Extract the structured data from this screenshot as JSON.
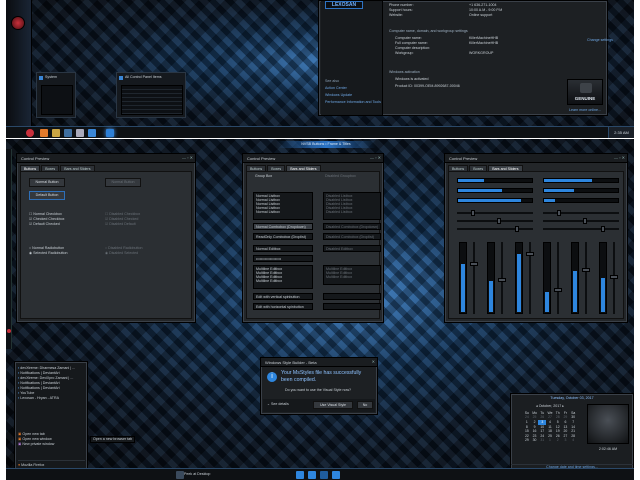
{
  "p1": {
    "logo": "LEXOSAN",
    "system_info": [
      {
        "label": "Phone number:",
        "value": "+1 636-271-1004"
      },
      {
        "label": "Support hours:",
        "value": "10:00 A.M - 9:00 P.M"
      },
      {
        "label": "Website:",
        "value": "Online support"
      }
    ],
    "section_computer": "Computer name, domain, and workgroup settings",
    "computer_rows": [
      {
        "label": "Computer name:",
        "value": "KillerMachineHHB"
      },
      {
        "label": "Full computer name:",
        "value": "KillerMachineHHB"
      },
      {
        "label": "Computer description:",
        "value": ""
      },
      {
        "label": "Workgroup:",
        "value": "WORKGROUP"
      }
    ],
    "change_settings": "Change settings",
    "section_activation": "Windows activation",
    "activation_status": "Windows is activated",
    "product_id": "Product ID: 00399-OEM-8992687-00046",
    "genuine": "GENUINE",
    "learn_more": "Learn more online...",
    "see_also_title": "See also",
    "see_also": [
      "Action Center",
      "Windows Update",
      "Performance Information and Tools"
    ],
    "thumb1": "System",
    "thumb2": "All Control Panel Items",
    "clock": "2:35 AM"
  },
  "p2": {
    "cp1": {
      "title": "Control Preview",
      "tabs": [
        "Buttons",
        "Boxes",
        "Bars and Sliders"
      ],
      "normal_button": "Normal Button",
      "default_button": "Default Button",
      "disabled_button": "Normal Button",
      "checks": [
        "Normal Checkbox",
        "Checked Checkbox",
        "Default Checked"
      ],
      "checks_disabled": [
        "Disabled Checkbox",
        "Disabled Checked",
        "Disabled Default"
      ],
      "radios": [
        "Normal Radiobutton",
        "Selected Radiobutton"
      ],
      "radios_disabled": [
        "Disabled Radiobutton",
        "Disabled Selected"
      ]
    },
    "cp2": {
      "title": "Control Preview",
      "tabs": [
        "Buttons",
        "Boxes",
        "Bars and Sliders"
      ],
      "group_box": "Group Box",
      "disabled_group": "Disabled Groupbox",
      "list_items": [
        "Normal Listbox",
        "Normal Listbox",
        "Normal Listbox",
        "Normal Listbox",
        "Normal Listbox"
      ],
      "list_items_disabled": [
        "Disabled Listbox",
        "Disabled Listbox",
        "Disabled Listbox",
        "Disabled Listbox",
        "Disabled Listbox"
      ],
      "combo_normal": "Normal Combobox (Dropdown)",
      "combo_disabled": "Disabled Combobox (Dropdown)",
      "combo_readonly": "ReadOnly Combobox (Droplist)",
      "combo_readonly_disabled": "Disabled Combobox (Droplist)",
      "edit_normal": "Normal Editbox",
      "edit_disabled": "Disabled Editbox",
      "password": "••••••••••••••••••••",
      "multiline": [
        "Multiline Editbox",
        "Multiline Editbox",
        "Multiline Editbox",
        "Multiline Editbox"
      ],
      "multiline_disabled": [
        "Multiline Editbox",
        "Multiline Editbox",
        "Multiline Editbox"
      ],
      "spin_vertical": "Edit with vertical spinbutton",
      "spin_horizontal": "Edit with horizontal spinbutton"
    },
    "cp3": {
      "title": "Control Preview",
      "tabs": [
        "Buttons",
        "Boxes",
        "Bars and Sliders"
      ],
      "h_progress": [
        0.35,
        0.6,
        0.85
      ],
      "h_sliders": [
        0.2,
        0.55,
        0.8
      ],
      "v_levels": [
        0.7,
        0.45,
        0.85,
        0.3,
        0.6,
        0.5
      ]
    },
    "jumplist": {
      "items": [
        "devXtreme: Dharmesa Zamani | ...",
        "Notifications | DeviantArt",
        "devXtreme: DeviXpro Zamani | ...",
        "Notifications | DeviantArt",
        "Notifications | DeviantArt",
        "YouTube",
        "Lexosan - Hryan - ATRA"
      ],
      "tasks": [
        "Open new tab",
        "Open new window",
        "New private window"
      ],
      "pin": "Mozilla Firefox",
      "unpin": "Unpin this program from taskbar",
      "tooltip": "Open a new browser tab"
    },
    "dialog": {
      "title": "Windows Style Builder - Beta",
      "message": "Your MsStyles file has successfully been compiled.",
      "question": "Do you want to use the Visual Style now?",
      "see_details": "See details",
      "use_now": "Use Visual Style",
      "no": "No"
    },
    "calendar": {
      "header": "Tuesday, October 03, 2017",
      "time": "2:02:46 AM",
      "month": "October, 2017",
      "days": [
        "Su",
        "Mo",
        "Tu",
        "We",
        "Th",
        "Fr",
        "Sa"
      ],
      "dates": [
        "24",
        "25",
        "26",
        "27",
        "28",
        "29",
        "30",
        "1",
        "2",
        "3",
        "4",
        "5",
        "6",
        "7",
        "8",
        "9",
        "10",
        "11",
        "12",
        "13",
        "14",
        "15",
        "16",
        "17",
        "18",
        "19",
        "20",
        "21",
        "22",
        "23",
        "24",
        "25",
        "26",
        "27",
        "28",
        "29",
        "30",
        "31",
        "1",
        "2",
        "3",
        "4"
      ],
      "today_index": 9,
      "footer": "Change date and time settings..."
    },
    "aero_peek": "Peek at Desktop",
    "top_bar": "NVSB Buttons  •  Frame & Titles"
  }
}
